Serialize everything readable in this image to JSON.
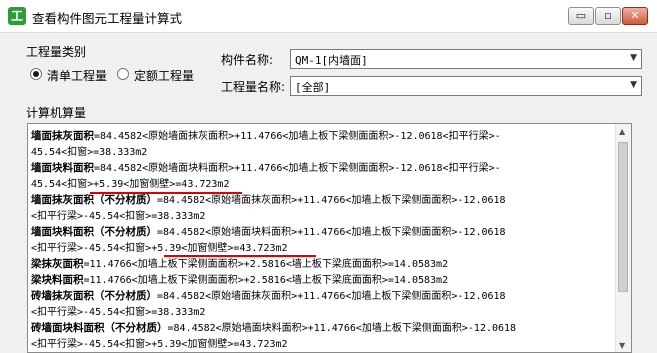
{
  "window": {
    "title": "查看构件图元工程量计算式",
    "app_icon": "工",
    "controls": {
      "minimize": "▭",
      "maximize": "▫",
      "close": "✕"
    }
  },
  "quantity_type": {
    "label": "工程量类别",
    "options": [
      {
        "label": "清单工程量",
        "selected": true
      },
      {
        "label": "定额工程量",
        "selected": false
      }
    ]
  },
  "component_name": {
    "label": "构件名称:",
    "value": "QM-1[内墙面]"
  },
  "quantity_name": {
    "label": "工程量名称:",
    "value": "[全部]"
  },
  "calc": {
    "label": "计算机算量",
    "lines": [
      {
        "bold": "墙面抹灰面积",
        "rest": "=84.4582<原始墙面抹灰面积>+11.4766<加墙上板下梁侧面面积>-12.0618<扣平行梁>-"
      },
      {
        "bold": "",
        "rest": "45.54<扣窗>=38.333m2"
      },
      {
        "bold": "墙面块料面积",
        "rest": "=84.4582<原始墙面块料面积>+11.4766<加墙上板下梁侧面面积>-12.0618<扣平行梁>-"
      },
      {
        "bold": "",
        "rest": "45.54<扣窗>+5.39<加窗侧壁>=43.723m2"
      },
      {
        "bold": "墙面抹灰面积（不分材质）",
        "rest": "=84.4582<原始墙面抹灰面积>+11.4766<加墙上板下梁侧面面积>-12.0618"
      },
      {
        "bold": "",
        "rest": "<扣平行梁>-45.54<扣窗>=38.333m2"
      },
      {
        "bold": "墙面块料面积（不分材质）",
        "rest": "=84.4582<原始墙面块料面积>+11.4766<加墙上板下梁侧面面积>-12.0618"
      },
      {
        "bold": "",
        "rest": "<扣平行梁>-45.54<扣窗>+5.39<加窗侧壁>=43.723m2"
      },
      {
        "bold": "梁抹灰面积",
        "rest": "=11.4766<加墙上板下梁侧面面积>+2.5816<墙上板下梁底面面积>=14.0583m2"
      },
      {
        "bold": "梁块料面积",
        "rest": "=11.4766<加墙上板下梁侧面面积>+2.5816<墙上板下梁底面面积>=14.0583m2"
      },
      {
        "bold": "砖墙抹灰面积（不分材质）",
        "rest": "=84.4582<原始墙面抹灰面积>+11.4766<加墙上板下梁侧面面积>-12.0618"
      },
      {
        "bold": "",
        "rest": "<扣平行梁>-45.54<扣窗>=38.333m2"
      },
      {
        "bold": "砖墙面块料面积（不分材质）",
        "rest": "=84.4582<原始墙面块料面积>+11.4766<加墙上板下梁侧面面积>-12.0618"
      },
      {
        "bold": "",
        "rest": "<扣平行梁>-45.54<扣窗>+5.39<加窗侧壁>=43.723m2"
      }
    ]
  },
  "colors": {
    "highlight": "#e00000",
    "app_icon": "#2f9a3c"
  }
}
